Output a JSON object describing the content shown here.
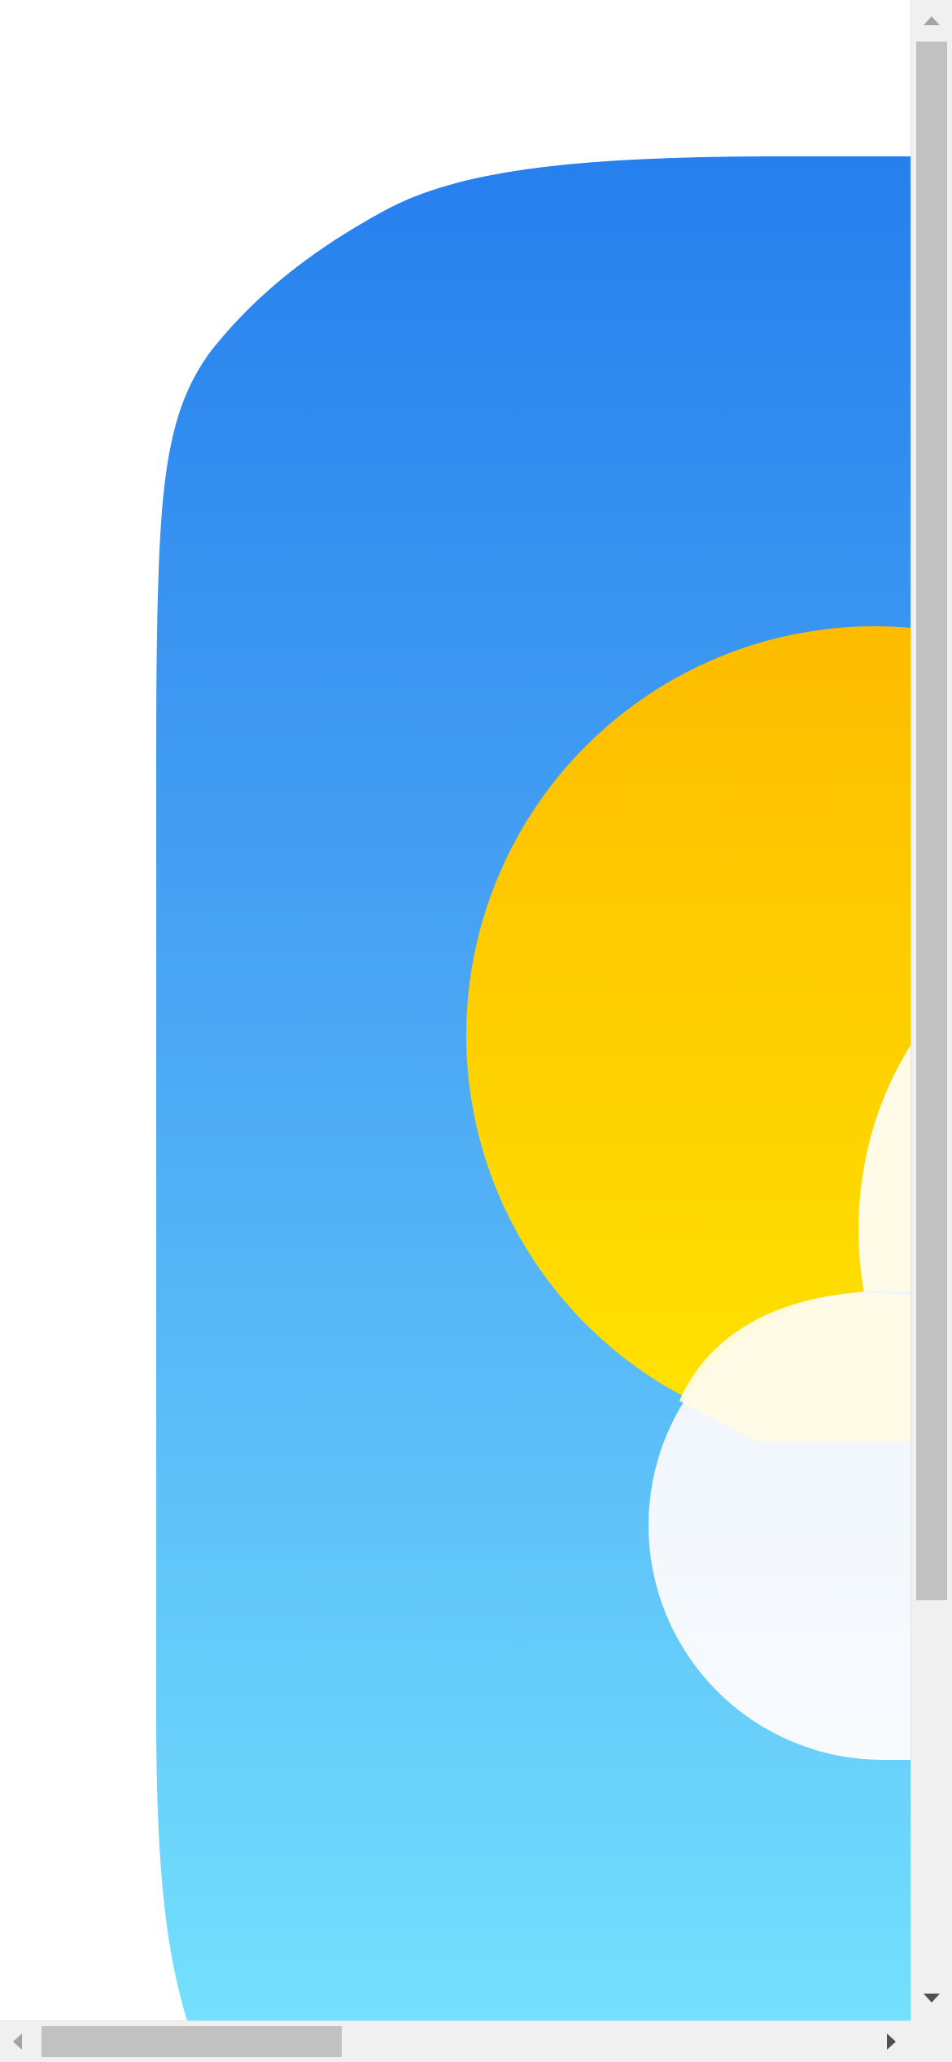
{
  "image": {
    "subject": "weather-app-icon",
    "colors": {
      "sky_top": "#1f78ec",
      "sky_mid": "#4aa6f4",
      "sky_bottom": "#74e0fd",
      "sun_top": "#fdbc00",
      "sun_bottom": "#ffe300",
      "cloud": "#f7fafd",
      "page_background": "#ffffff"
    }
  },
  "scrollbars": {
    "vertical": {
      "up_icon": "triangle-up",
      "down_icon": "triangle-down",
      "thumb_color": "#c1c1c1",
      "track_color": "#f0f0f0"
    },
    "horizontal": {
      "left_icon": "triangle-left",
      "right_icon": "triangle-right",
      "thumb_color": "#c1c1c1",
      "track_color": "#f0f0f0"
    }
  }
}
